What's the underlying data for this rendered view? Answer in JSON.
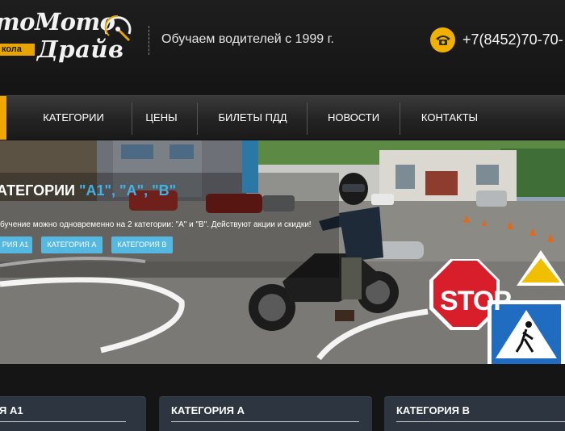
{
  "header": {
    "logo_top": "тоМото",
    "logo_school": "кола",
    "logo_bottom": "Драйв",
    "slogan": "Обучаем водителей с 1999 г.",
    "phone": "+7(8452)70-70-",
    "phone_icon": "telephone-icon",
    "accent_color": "#f0a800"
  },
  "nav": {
    "items": [
      {
        "label": "КАТЕГОРИИ"
      },
      {
        "label": "ЦЕНЫ"
      },
      {
        "label": "БИЛЕТЫ ПДД"
      },
      {
        "label": "НОВОСТИ"
      },
      {
        "label": "КОНТАКТЫ"
      }
    ]
  },
  "hero": {
    "title_prefix": "АТЕГОРИИ ",
    "title_highlight": "\"А1\", \"А\", \"В\"",
    "text": "бучение можно одновременно на 2 категории: \"А\" и \"В\". Действуют акции и скидки!",
    "buttons": [
      {
        "label": "РИЯ А1"
      },
      {
        "label": "КАТЕГОРИЯ А"
      },
      {
        "label": "КАТЕГОРИЯ В"
      }
    ],
    "sign_text": "STOP",
    "highlight_color": "#3fb3e6"
  },
  "cards": [
    {
      "title": "Я А1"
    },
    {
      "title": "КАТЕГОРИЯ А"
    },
    {
      "title": "КАТЕГОРИЯ В"
    }
  ]
}
